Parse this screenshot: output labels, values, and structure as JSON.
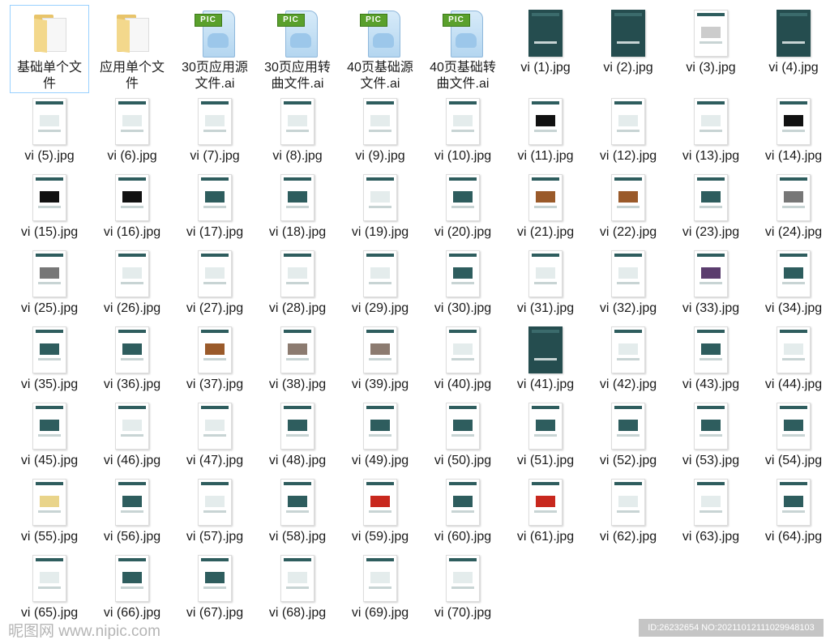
{
  "items": [
    {
      "label": "基础单个文件",
      "type": "folder",
      "selected": true
    },
    {
      "label": "应用单个文件",
      "type": "folder"
    },
    {
      "label": "30页应用源文件.ai",
      "type": "ai"
    },
    {
      "label": "30页应用转曲文件.ai",
      "type": "ai"
    },
    {
      "label": "40页基础源文件.ai",
      "type": "ai"
    },
    {
      "label": "40页基础转曲文件.ai",
      "type": "ai"
    },
    {
      "label": "vi (1).jpg",
      "type": "jpg",
      "thumb": "dark"
    },
    {
      "label": "vi (2).jpg",
      "type": "jpg",
      "thumb": "dark"
    },
    {
      "label": "vi (3).jpg",
      "type": "jpg",
      "thumb": "text"
    },
    {
      "label": "vi (4).jpg",
      "type": "jpg",
      "thumb": "dark"
    },
    {
      "label": "vi (5).jpg",
      "type": "jpg"
    },
    {
      "label": "vi (6).jpg",
      "type": "jpg"
    },
    {
      "label": "vi (7).jpg",
      "type": "jpg"
    },
    {
      "label": "vi (8).jpg",
      "type": "jpg"
    },
    {
      "label": "vi (9).jpg",
      "type": "jpg"
    },
    {
      "label": "vi (10).jpg",
      "type": "jpg"
    },
    {
      "label": "vi (11).jpg",
      "type": "jpg",
      "thumb": "black"
    },
    {
      "label": "vi (12).jpg",
      "type": "jpg"
    },
    {
      "label": "vi (13).jpg",
      "type": "jpg"
    },
    {
      "label": "vi (14).jpg",
      "type": "jpg",
      "thumb": "black"
    },
    {
      "label": "vi (15).jpg",
      "type": "jpg",
      "thumb": "black"
    },
    {
      "label": "vi (16).jpg",
      "type": "jpg",
      "thumb": "black"
    },
    {
      "label": "vi (17).jpg",
      "type": "jpg",
      "thumb": "teal"
    },
    {
      "label": "vi (18).jpg",
      "type": "jpg",
      "thumb": "teal"
    },
    {
      "label": "vi (19).jpg",
      "type": "jpg"
    },
    {
      "label": "vi (20).jpg",
      "type": "jpg",
      "thumb": "teal"
    },
    {
      "label": "vi (21).jpg",
      "type": "jpg",
      "thumb": "brown"
    },
    {
      "label": "vi (22).jpg",
      "type": "jpg",
      "thumb": "brown"
    },
    {
      "label": "vi (23).jpg",
      "type": "jpg",
      "thumb": "teal"
    },
    {
      "label": "vi (24).jpg",
      "type": "jpg",
      "thumb": "gray"
    },
    {
      "label": "vi (25).jpg",
      "type": "jpg",
      "thumb": "gray"
    },
    {
      "label": "vi (26).jpg",
      "type": "jpg"
    },
    {
      "label": "vi (27).jpg",
      "type": "jpg"
    },
    {
      "label": "vi (28).jpg",
      "type": "jpg"
    },
    {
      "label": "vi (29).jpg",
      "type": "jpg"
    },
    {
      "label": "vi (30).jpg",
      "type": "jpg",
      "thumb": "teal"
    },
    {
      "label": "vi (31).jpg",
      "type": "jpg"
    },
    {
      "label": "vi (32).jpg",
      "type": "jpg"
    },
    {
      "label": "vi (33).jpg",
      "type": "jpg",
      "thumb": "purple"
    },
    {
      "label": "vi (34).jpg",
      "type": "jpg",
      "thumb": "teal"
    },
    {
      "label": "vi (35).jpg",
      "type": "jpg",
      "thumb": "teal"
    },
    {
      "label": "vi (36).jpg",
      "type": "jpg",
      "thumb": "teal"
    },
    {
      "label": "vi (37).jpg",
      "type": "jpg",
      "thumb": "brown"
    },
    {
      "label": "vi (38).jpg",
      "type": "jpg",
      "thumb": "taupe"
    },
    {
      "label": "vi (39).jpg",
      "type": "jpg",
      "thumb": "taupe"
    },
    {
      "label": "vi (40).jpg",
      "type": "jpg"
    },
    {
      "label": "vi (41).jpg",
      "type": "jpg",
      "thumb": "dark"
    },
    {
      "label": "vi (42).jpg",
      "type": "jpg"
    },
    {
      "label": "vi (43).jpg",
      "type": "jpg",
      "thumb": "teal"
    },
    {
      "label": "vi (44).jpg",
      "type": "jpg"
    },
    {
      "label": "vi (45).jpg",
      "type": "jpg",
      "thumb": "teal"
    },
    {
      "label": "vi (46).jpg",
      "type": "jpg"
    },
    {
      "label": "vi (47).jpg",
      "type": "jpg"
    },
    {
      "label": "vi (48).jpg",
      "type": "jpg",
      "thumb": "teal"
    },
    {
      "label": "vi (49).jpg",
      "type": "jpg",
      "thumb": "teal"
    },
    {
      "label": "vi (50).jpg",
      "type": "jpg",
      "thumb": "teal"
    },
    {
      "label": "vi (51).jpg",
      "type": "jpg",
      "thumb": "teal"
    },
    {
      "label": "vi (52).jpg",
      "type": "jpg",
      "thumb": "teal"
    },
    {
      "label": "vi (53).jpg",
      "type": "jpg",
      "thumb": "teal"
    },
    {
      "label": "vi (54).jpg",
      "type": "jpg",
      "thumb": "teal"
    },
    {
      "label": "vi (55).jpg",
      "type": "jpg",
      "thumb": "yellow"
    },
    {
      "label": "vi (56).jpg",
      "type": "jpg",
      "thumb": "teal"
    },
    {
      "label": "vi (57).jpg",
      "type": "jpg"
    },
    {
      "label": "vi (58).jpg",
      "type": "jpg",
      "thumb": "teal"
    },
    {
      "label": "vi (59).jpg",
      "type": "jpg",
      "thumb": "red"
    },
    {
      "label": "vi (60).jpg",
      "type": "jpg",
      "thumb": "teal"
    },
    {
      "label": "vi (61).jpg",
      "type": "jpg",
      "thumb": "red"
    },
    {
      "label": "vi (62).jpg",
      "type": "jpg"
    },
    {
      "label": "vi (63).jpg",
      "type": "jpg"
    },
    {
      "label": "vi (64).jpg",
      "type": "jpg",
      "thumb": "teal"
    },
    {
      "label": "vi (65).jpg",
      "type": "jpg"
    },
    {
      "label": "vi (66).jpg",
      "type": "jpg",
      "thumb": "teal"
    },
    {
      "label": "vi (67).jpg",
      "type": "jpg",
      "thumb": "teal"
    },
    {
      "label": "vi (68).jpg",
      "type": "jpg"
    },
    {
      "label": "vi (69).jpg",
      "type": "jpg"
    },
    {
      "label": "vi (70).jpg",
      "type": "jpg"
    }
  ],
  "pic_tag": "PIC",
  "thumb_colors": {
    "teal": "#2e5d5e",
    "black": "#111111",
    "brown": "#9a5a2a",
    "gray": "#777777",
    "purple": "#5b3d6e",
    "taupe": "#8c7b70",
    "yellow": "#e9d48a",
    "red": "#c8281e",
    "text": "#cccccc"
  },
  "watermark": {
    "site": "昵图网 www.nipic.com",
    "id": "ID:26232654 NO:20211012111029948103"
  }
}
